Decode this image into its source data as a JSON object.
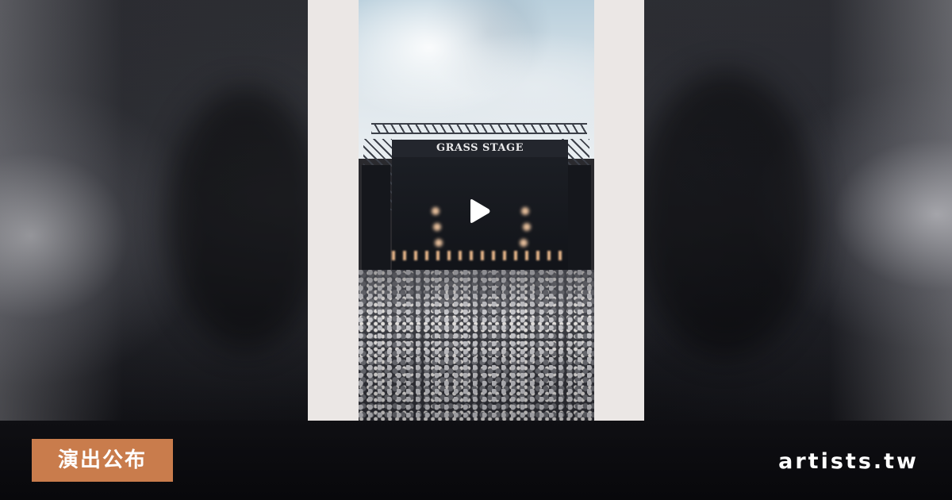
{
  "video": {
    "stage_sign": "GRASS STAGE",
    "play_icon": "play-icon"
  },
  "badge": {
    "label": "演出公布"
  },
  "brand": {
    "label": "artists.tw"
  },
  "colors": {
    "badge_bg": "#c97c4c",
    "card_bg": "#ebe7e5",
    "bar_bg": "#0c0c10",
    "text": "#ffffff"
  }
}
